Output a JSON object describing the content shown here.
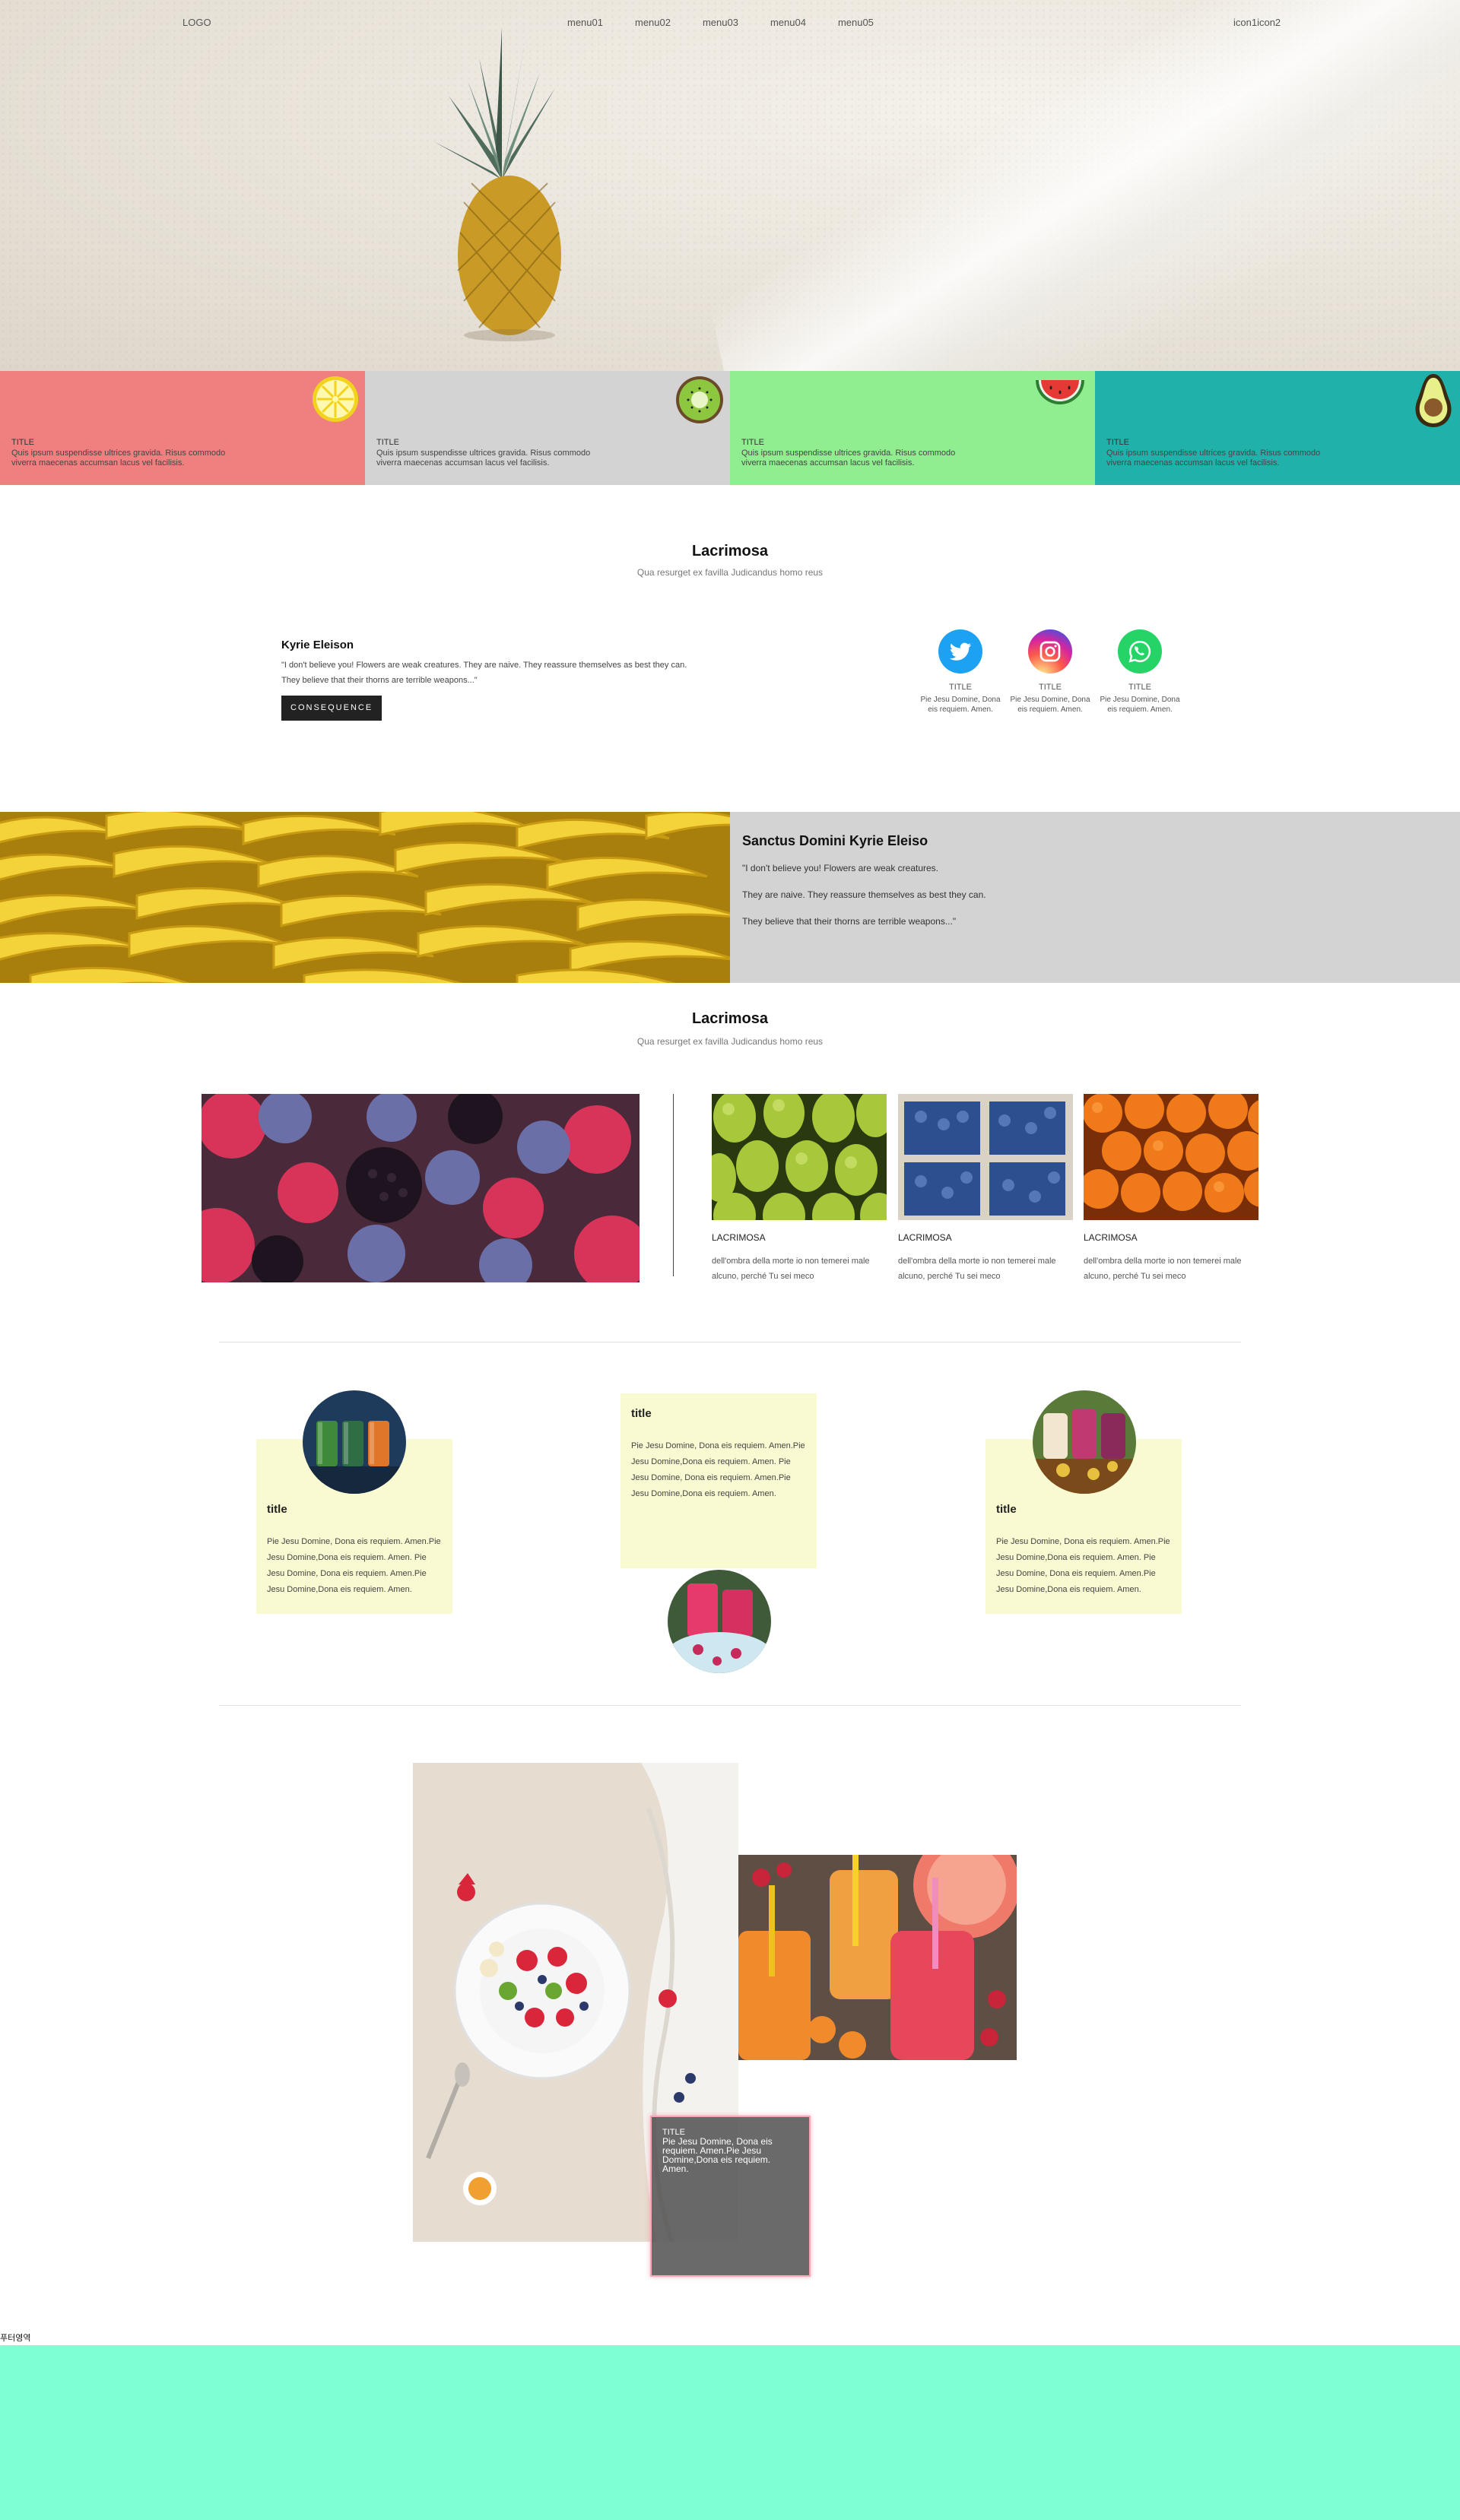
{
  "header": {
    "logo": "LOGO",
    "menu": [
      "menu01",
      "menu02",
      "menu03",
      "menu04",
      "menu05"
    ],
    "icons": "icon1icon2"
  },
  "cards": [
    {
      "title": "TITLE",
      "desc": "Quis ipsum suspendisse ultrices gravida. Risus commodo viverra maecenas accumsan lacus vel facilisis.",
      "bg": "#f08080",
      "fruit": "lemon-icon"
    },
    {
      "title": "TITLE",
      "desc": "Quis ipsum suspendisse ultrices gravida. Risus commodo viverra maecenas accumsan lacus vel facilisis.",
      "bg": "#d3d3d3",
      "fruit": "kiwi-icon"
    },
    {
      "title": "TITLE",
      "desc": "Quis ipsum suspendisse ultrices gravida. Risus commodo viverra maecenas accumsan lacus vel facilisis.",
      "bg": "#90ee90",
      "fruit": "watermelon-icon"
    },
    {
      "title": "TITLE",
      "desc": "Quis ipsum suspendisse ultrices gravida. Risus commodo viverra maecenas accumsan lacus vel facilisis.",
      "bg": "#20b2aa",
      "fruit": "avocado-icon"
    }
  ],
  "intro": {
    "title": "Lacrimosa",
    "subtitle": "Qua resurget ex favilla Judicandus homo reus",
    "heading": "Kyrie Eleison",
    "quote": "\"I don't believe you! Flowers are weak creatures. They are naive. They reassure themselves as best they can. They believe that their thorns are terrible weapons...\"",
    "button": "CONSEQUENCE",
    "socials": [
      {
        "label": "TITLE",
        "desc": "Pie Jesu Domine, Dona eis requiem. Amen.",
        "icon": "twitter-icon",
        "color": "#1da1f2"
      },
      {
        "label": "TITLE",
        "desc": "Pie Jesu Domine, Dona eis requiem. Amen.",
        "icon": "instagram-icon",
        "color": "#d6249f"
      },
      {
        "label": "TITLE",
        "desc": "Pie Jesu Domine, Dona eis requiem. Amen.",
        "icon": "whatsapp-icon",
        "color": "#25d366"
      }
    ]
  },
  "band": {
    "title": "Sanctus Domini Kyrie Eleiso",
    "lines": [
      "\"I don't believe you! Flowers are weak creatures.",
      "They are naive. They reassure themselves as best they can.",
      "They believe that their thorns are terrible weapons...\""
    ]
  },
  "gallery": {
    "title": "Lacrimosa",
    "subtitle": "Qua resurget ex favilla Judicandus homo reus",
    "items": [
      {
        "title": "LACRIMOSA",
        "desc": "dell'ombra della morte io non temerei male alcuno, perché Tu sei meco"
      },
      {
        "title": "LACRIMOSA",
        "desc": "dell'ombra della morte io non temerei male alcuno, perché Tu sei meco"
      },
      {
        "title": "LACRIMOSA",
        "desc": "dell'ombra della morte io non temerei male alcuno, perché Tu sei meco"
      }
    ]
  },
  "juice": [
    {
      "title": "title",
      "text": "Pie Jesu Domine, Dona eis requiem. Amen.Pie Jesu Domine,Dona eis requiem. Amen. Pie Jesu Domine, Dona eis requiem. Amen.Pie Jesu Domine,Dona eis requiem. Amen."
    },
    {
      "title": "title",
      "text": "Pie Jesu Domine, Dona eis requiem. Amen.Pie Jesu Domine,Dona eis requiem. Amen. Pie Jesu Domine, Dona eis requiem. Amen.Pie Jesu Domine,Dona eis requiem. Amen."
    },
    {
      "title": "title",
      "text": "Pie Jesu Domine, Dona eis requiem. Amen.Pie Jesu Domine,Dona eis requiem. Amen. Pie Jesu Domine, Dona eis requiem. Amen.Pie Jesu Domine,Dona eis requiem. Amen."
    }
  ],
  "overlay": {
    "title": "TITLE",
    "text": "Pie Jesu Domine, Dona eis requiem. Amen.Pie Jesu Domine,Dona eis requiem. Amen."
  },
  "footer": {
    "label": "푸터영역",
    "color": "#7fffd4"
  }
}
